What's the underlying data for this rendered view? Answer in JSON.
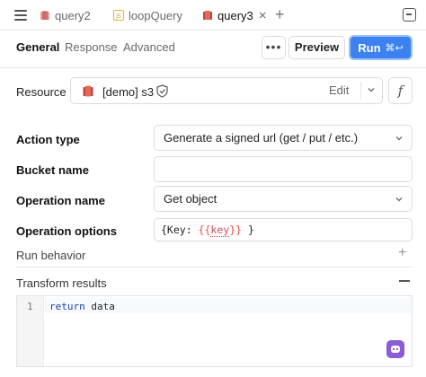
{
  "tabs": [
    {
      "label": "query2",
      "icon": "s3-bucket-icon",
      "active": false
    },
    {
      "label": "loopQuery",
      "icon": "javascript-icon",
      "active": false
    },
    {
      "label": "query3",
      "icon": "s3-bucket-icon",
      "active": true
    }
  ],
  "subtabs": [
    "General",
    "Response",
    "Advanced"
  ],
  "toolbar": {
    "more_label": "•••",
    "preview_label": "Preview",
    "run_label": "Run",
    "run_shortcut": "⌘↩"
  },
  "resource": {
    "label": "Resource",
    "value": "[demo] s3",
    "edit_label": "Edit",
    "fx_label": "f"
  },
  "form": {
    "action_type": {
      "label": "Action type",
      "value": "Generate a signed url (get / put / etc.)"
    },
    "bucket_name": {
      "label": "Bucket name",
      "value": ""
    },
    "operation_name": {
      "label": "Operation name",
      "value": "Get object"
    },
    "operation_options": {
      "label": "Operation options",
      "prefix": "{Key: ",
      "tmpl_open": "{{",
      "tmpl_var": "key",
      "tmpl_close": "}}",
      "suffix": " }"
    }
  },
  "run_behavior": {
    "label": "Run behavior",
    "plus": "+"
  },
  "transform": {
    "label": "Transform results",
    "line_number": "1",
    "code_keyword": "return",
    "code_rest": " data"
  },
  "colors": {
    "accent": "#3b82f0",
    "ai": "#8a5cd8",
    "s3": "#c7413a"
  }
}
